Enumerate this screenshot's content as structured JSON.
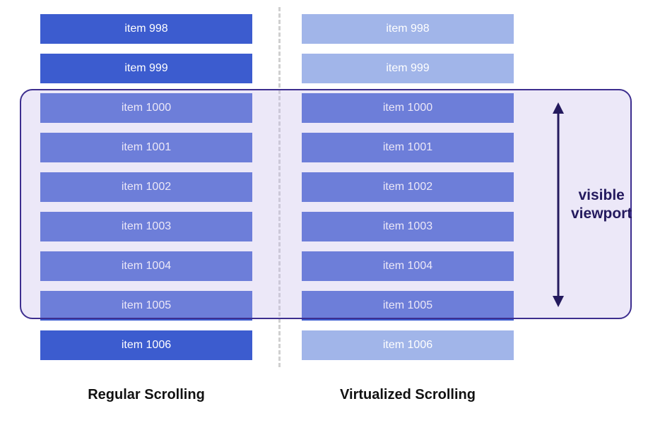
{
  "left": {
    "caption": "Regular Scrolling",
    "items": [
      {
        "label": "item 998",
        "style": "solid"
      },
      {
        "label": "item 999",
        "style": "solid"
      },
      {
        "label": "item 1000",
        "style": "solid"
      },
      {
        "label": "item 1001",
        "style": "solid"
      },
      {
        "label": "item 1002",
        "style": "solid"
      },
      {
        "label": "item 1003",
        "style": "solid"
      },
      {
        "label": "item 1004",
        "style": "solid"
      },
      {
        "label": "item 1005",
        "style": "solid"
      },
      {
        "label": "item 1006",
        "style": "solid"
      }
    ]
  },
  "right": {
    "caption": "Virtualized Scrolling",
    "items": [
      {
        "label": "item 998",
        "style": "faded"
      },
      {
        "label": "item 999",
        "style": "faded"
      },
      {
        "label": "item 1000",
        "style": "solid"
      },
      {
        "label": "item 1001",
        "style": "solid"
      },
      {
        "label": "item 1002",
        "style": "solid"
      },
      {
        "label": "item 1003",
        "style": "solid"
      },
      {
        "label": "item 1004",
        "style": "solid"
      },
      {
        "label": "item 1005",
        "style": "solid"
      },
      {
        "label": "item 1006",
        "style": "faded"
      }
    ]
  },
  "viewport": {
    "label_line1": "visible",
    "label_line2": "viewport"
  },
  "colors": {
    "item_solid": "#3c5ccf",
    "item_faded": "#a1b5e9",
    "viewport_border": "#3d2e8f",
    "viewport_fill": "rgba(200, 190, 235, 0.35)"
  }
}
